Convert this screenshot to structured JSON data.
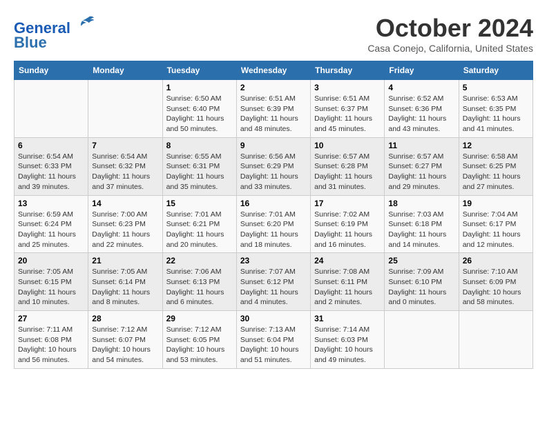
{
  "header": {
    "logo_line1": "General",
    "logo_line2": "Blue",
    "month_title": "October 2024",
    "location": "Casa Conejo, California, United States"
  },
  "days_of_week": [
    "Sunday",
    "Monday",
    "Tuesday",
    "Wednesday",
    "Thursday",
    "Friday",
    "Saturday"
  ],
  "weeks": [
    [
      {
        "day": "",
        "sunrise": "",
        "sunset": "",
        "daylight": ""
      },
      {
        "day": "",
        "sunrise": "",
        "sunset": "",
        "daylight": ""
      },
      {
        "day": "1",
        "sunrise": "Sunrise: 6:50 AM",
        "sunset": "Sunset: 6:40 PM",
        "daylight": "Daylight: 11 hours and 50 minutes."
      },
      {
        "day": "2",
        "sunrise": "Sunrise: 6:51 AM",
        "sunset": "Sunset: 6:39 PM",
        "daylight": "Daylight: 11 hours and 48 minutes."
      },
      {
        "day": "3",
        "sunrise": "Sunrise: 6:51 AM",
        "sunset": "Sunset: 6:37 PM",
        "daylight": "Daylight: 11 hours and 45 minutes."
      },
      {
        "day": "4",
        "sunrise": "Sunrise: 6:52 AM",
        "sunset": "Sunset: 6:36 PM",
        "daylight": "Daylight: 11 hours and 43 minutes."
      },
      {
        "day": "5",
        "sunrise": "Sunrise: 6:53 AM",
        "sunset": "Sunset: 6:35 PM",
        "daylight": "Daylight: 11 hours and 41 minutes."
      }
    ],
    [
      {
        "day": "6",
        "sunrise": "Sunrise: 6:54 AM",
        "sunset": "Sunset: 6:33 PM",
        "daylight": "Daylight: 11 hours and 39 minutes."
      },
      {
        "day": "7",
        "sunrise": "Sunrise: 6:54 AM",
        "sunset": "Sunset: 6:32 PM",
        "daylight": "Daylight: 11 hours and 37 minutes."
      },
      {
        "day": "8",
        "sunrise": "Sunrise: 6:55 AM",
        "sunset": "Sunset: 6:31 PM",
        "daylight": "Daylight: 11 hours and 35 minutes."
      },
      {
        "day": "9",
        "sunrise": "Sunrise: 6:56 AM",
        "sunset": "Sunset: 6:29 PM",
        "daylight": "Daylight: 11 hours and 33 minutes."
      },
      {
        "day": "10",
        "sunrise": "Sunrise: 6:57 AM",
        "sunset": "Sunset: 6:28 PM",
        "daylight": "Daylight: 11 hours and 31 minutes."
      },
      {
        "day": "11",
        "sunrise": "Sunrise: 6:57 AM",
        "sunset": "Sunset: 6:27 PM",
        "daylight": "Daylight: 11 hours and 29 minutes."
      },
      {
        "day": "12",
        "sunrise": "Sunrise: 6:58 AM",
        "sunset": "Sunset: 6:25 PM",
        "daylight": "Daylight: 11 hours and 27 minutes."
      }
    ],
    [
      {
        "day": "13",
        "sunrise": "Sunrise: 6:59 AM",
        "sunset": "Sunset: 6:24 PM",
        "daylight": "Daylight: 11 hours and 25 minutes."
      },
      {
        "day": "14",
        "sunrise": "Sunrise: 7:00 AM",
        "sunset": "Sunset: 6:23 PM",
        "daylight": "Daylight: 11 hours and 22 minutes."
      },
      {
        "day": "15",
        "sunrise": "Sunrise: 7:01 AM",
        "sunset": "Sunset: 6:21 PM",
        "daylight": "Daylight: 11 hours and 20 minutes."
      },
      {
        "day": "16",
        "sunrise": "Sunrise: 7:01 AM",
        "sunset": "Sunset: 6:20 PM",
        "daylight": "Daylight: 11 hours and 18 minutes."
      },
      {
        "day": "17",
        "sunrise": "Sunrise: 7:02 AM",
        "sunset": "Sunset: 6:19 PM",
        "daylight": "Daylight: 11 hours and 16 minutes."
      },
      {
        "day": "18",
        "sunrise": "Sunrise: 7:03 AM",
        "sunset": "Sunset: 6:18 PM",
        "daylight": "Daylight: 11 hours and 14 minutes."
      },
      {
        "day": "19",
        "sunrise": "Sunrise: 7:04 AM",
        "sunset": "Sunset: 6:17 PM",
        "daylight": "Daylight: 11 hours and 12 minutes."
      }
    ],
    [
      {
        "day": "20",
        "sunrise": "Sunrise: 7:05 AM",
        "sunset": "Sunset: 6:15 PM",
        "daylight": "Daylight: 11 hours and 10 minutes."
      },
      {
        "day": "21",
        "sunrise": "Sunrise: 7:05 AM",
        "sunset": "Sunset: 6:14 PM",
        "daylight": "Daylight: 11 hours and 8 minutes."
      },
      {
        "day": "22",
        "sunrise": "Sunrise: 7:06 AM",
        "sunset": "Sunset: 6:13 PM",
        "daylight": "Daylight: 11 hours and 6 minutes."
      },
      {
        "day": "23",
        "sunrise": "Sunrise: 7:07 AM",
        "sunset": "Sunset: 6:12 PM",
        "daylight": "Daylight: 11 hours and 4 minutes."
      },
      {
        "day": "24",
        "sunrise": "Sunrise: 7:08 AM",
        "sunset": "Sunset: 6:11 PM",
        "daylight": "Daylight: 11 hours and 2 minutes."
      },
      {
        "day": "25",
        "sunrise": "Sunrise: 7:09 AM",
        "sunset": "Sunset: 6:10 PM",
        "daylight": "Daylight: 11 hours and 0 minutes."
      },
      {
        "day": "26",
        "sunrise": "Sunrise: 7:10 AM",
        "sunset": "Sunset: 6:09 PM",
        "daylight": "Daylight: 10 hours and 58 minutes."
      }
    ],
    [
      {
        "day": "27",
        "sunrise": "Sunrise: 7:11 AM",
        "sunset": "Sunset: 6:08 PM",
        "daylight": "Daylight: 10 hours and 56 minutes."
      },
      {
        "day": "28",
        "sunrise": "Sunrise: 7:12 AM",
        "sunset": "Sunset: 6:07 PM",
        "daylight": "Daylight: 10 hours and 54 minutes."
      },
      {
        "day": "29",
        "sunrise": "Sunrise: 7:12 AM",
        "sunset": "Sunset: 6:05 PM",
        "daylight": "Daylight: 10 hours and 53 minutes."
      },
      {
        "day": "30",
        "sunrise": "Sunrise: 7:13 AM",
        "sunset": "Sunset: 6:04 PM",
        "daylight": "Daylight: 10 hours and 51 minutes."
      },
      {
        "day": "31",
        "sunrise": "Sunrise: 7:14 AM",
        "sunset": "Sunset: 6:03 PM",
        "daylight": "Daylight: 10 hours and 49 minutes."
      },
      {
        "day": "",
        "sunrise": "",
        "sunset": "",
        "daylight": ""
      },
      {
        "day": "",
        "sunrise": "",
        "sunset": "",
        "daylight": ""
      }
    ]
  ]
}
